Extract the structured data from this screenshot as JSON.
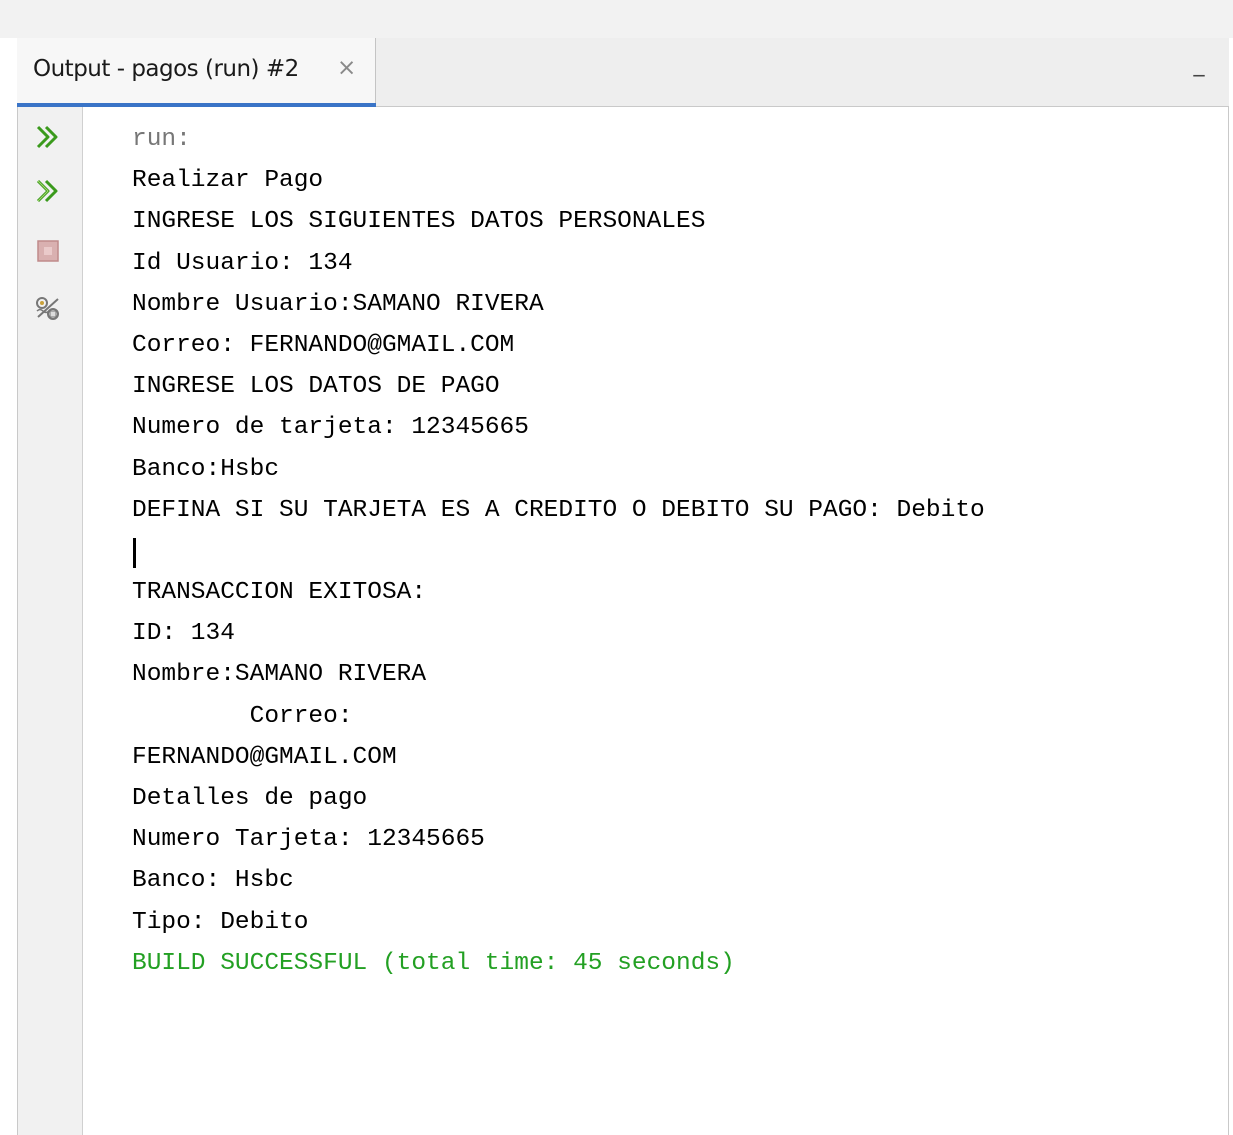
{
  "window": {
    "tab_title": "Output - pagos (run) #2",
    "tab_close_glyph": "×",
    "minimize_glyph": "_"
  },
  "toolbar": {
    "buttons": [
      {
        "name": "rerun-icon",
        "color": "#3a9a1c"
      },
      {
        "name": "rerun-with-options-icon",
        "color": "#3a9a1c"
      },
      {
        "name": "stop-icon",
        "color": "#c98a8a"
      },
      {
        "name": "settings-icon",
        "color": "#888888"
      }
    ]
  },
  "console": {
    "colors": {
      "default": "#000000",
      "system": "#777777",
      "success": "#23a023"
    },
    "lines": [
      "run:",
      "Realizar Pago",
      "INGRESE LOS SIGUIENTES DATOS PERSONALES",
      "Id Usuario: 134",
      "Nombre Usuario:SAMANO RIVERA",
      "Correo: FERNANDO@GMAIL.COM",
      "INGRESE LOS DATOS DE PAGO",
      "Numero de tarjeta: 12345665",
      "Banco:Hsbc",
      "DEFINA SI SU TARJETA ES A CREDITO O DEBITO SU PAGO: Debito",
      "",
      "TRANSACCION EXITOSA:",
      "ID: 134",
      "Nombre:SAMANO RIVERA",
      "\tCorreo:",
      "FERNANDO@GMAIL.COM",
      "Detalles de pago",
      "Numero Tarjeta: 12345665",
      "Banco: Hsbc",
      "Tipo: Debito",
      "BUILD SUCCESSFUL (total time: 45 seconds)"
    ]
  }
}
